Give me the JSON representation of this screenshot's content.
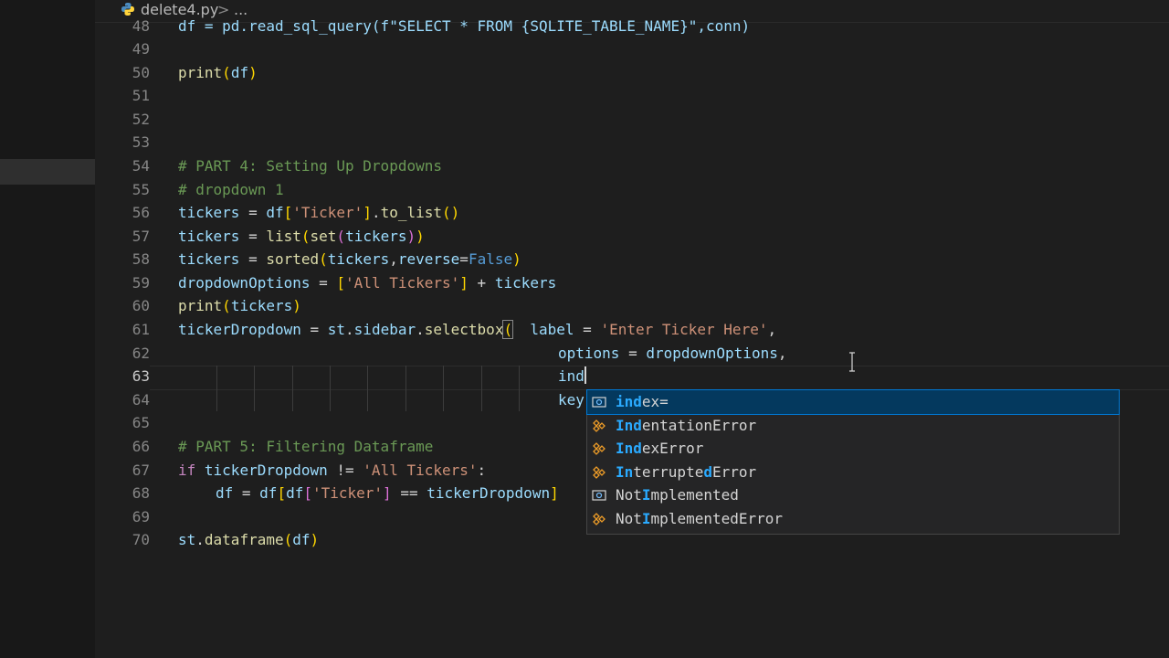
{
  "breadcrumb": {
    "file": "delete4.py",
    "separator": ">",
    "more": "..."
  },
  "gutter": {
    "line_numbers": [
      "48",
      "49",
      "50",
      "51",
      "52",
      "53",
      "54",
      "55",
      "56",
      "57",
      "58",
      "59",
      "60",
      "61",
      "62",
      "63",
      "64",
      "65",
      "66",
      "67",
      "68",
      "69",
      "70"
    ],
    "active_line": "63"
  },
  "code": {
    "l48": {
      "a": "df = pd.read_sql_query(f\"SELECT * FROM {SQLITE_TABLE_NAME}\",conn)"
    },
    "l50": {
      "a": "print",
      "b": "(",
      "c": "df",
      "d": ")"
    },
    "l54": "# PART 4: Setting Up Dropdowns",
    "l55": "# dropdown 1",
    "l56": {
      "a": "tickers",
      "b": " = ",
      "c": "df",
      "d": "[",
      "e": "'Ticker'",
      "f": "]",
      "g": ".",
      "h": "to_list",
      "i": "()"
    },
    "l57": {
      "a": "tickers",
      "b": " = ",
      "c": "list",
      "d": "(",
      "e": "set",
      "f": "(",
      "g": "tickers",
      "h": ")",
      "i": ")"
    },
    "l58": {
      "a": "tickers",
      "b": " = ",
      "c": "sorted",
      "d": "(",
      "e": "tickers",
      "f": ",",
      "g": "reverse",
      "h": "=",
      "i": "False",
      "j": ")"
    },
    "l59": {
      "a": "dropdownOptions",
      "b": " = ",
      "c": "[",
      "d": "'All Tickers'",
      "e": "]",
      "f": " + ",
      "g": "tickers"
    },
    "l60": {
      "a": "print",
      "b": "(",
      "c": "tickers",
      "d": ")"
    },
    "l61": {
      "a": "tickerDropdown",
      "b": " = ",
      "c": "st",
      "d": ".",
      "e": "sidebar",
      "f": ".",
      "g": "selectbox",
      "h": "(",
      "i": "  label",
      "j": " = ",
      "k": "'Enter Ticker Here'",
      "l": ","
    },
    "l62": {
      "a": "options",
      "b": " = ",
      "c": "dropdownOptions",
      "d": ","
    },
    "l63": {
      "a": "ind"
    },
    "l64": {
      "a": "key"
    },
    "l66": "# PART 5: Filtering Dataframe",
    "l67": {
      "a": "if",
      "b": " ",
      "c": "tickerDropdown",
      "d": " != ",
      "e": "'All Tickers'",
      "f": ":"
    },
    "l68": {
      "a": "df",
      "b": " = ",
      "c": "df",
      "d": "[",
      "e": "df",
      "f": "[",
      "g": "'Ticker'",
      "h": "]",
      "i": " == ",
      "j": "tickerDropdown",
      "k": "]"
    },
    "l70": {
      "a": "st",
      "b": ".",
      "c": "dataframe",
      "d": "(",
      "e": "df",
      "f": ")"
    }
  },
  "suggestions": [
    {
      "pre": "",
      "hl": "ind",
      "post": "ex=",
      "icon": "variable-icon",
      "selected": true
    },
    {
      "pre": "",
      "hl": "Ind",
      "post": "entationError",
      "icon": "class-icon",
      "selected": false
    },
    {
      "pre": "",
      "hl": "Ind",
      "post": "exError",
      "icon": "class-icon",
      "selected": false
    },
    {
      "pre": "",
      "hl": "In",
      "post": "terrupte",
      "hl2": "d",
      "post2": "Error",
      "icon": "class-icon",
      "selected": false
    },
    {
      "pre": "N",
      "hl": "",
      "post": "ot",
      "hl2": "I",
      "post2": "mplemented",
      "icon": "variable-icon",
      "selected": false
    },
    {
      "pre": "N",
      "hl": "",
      "post": "ot",
      "hl2": "I",
      "post2": "mplementedError",
      "icon": "class-icon",
      "selected": false
    }
  ],
  "colors": {
    "background": "#1e1e1e",
    "selected_suggestion": "#04395e",
    "match_highlight": "#2aaaff"
  }
}
